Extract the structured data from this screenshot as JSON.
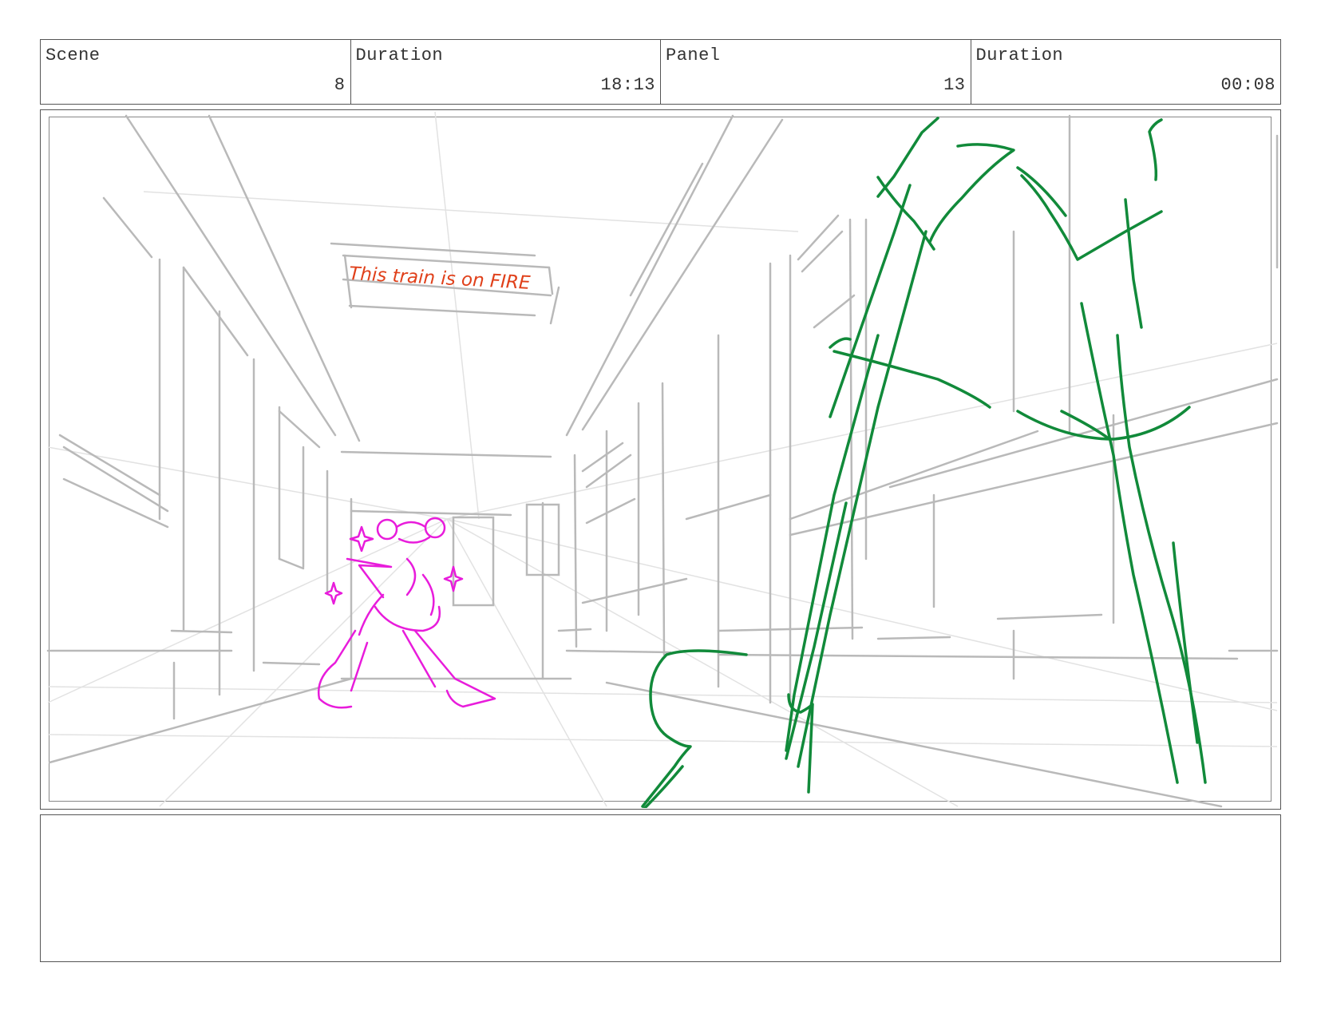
{
  "header": {
    "scene_label": "Scene",
    "scene_value": "8",
    "scene_duration_label": "Duration",
    "scene_duration_value": "18:13",
    "panel_label": "Panel",
    "panel_value": "13",
    "panel_duration_label": "Duration",
    "panel_duration_value": "00:08"
  },
  "panel": {
    "sign_text": "This train is on FIRE"
  },
  "colors": {
    "sketch_gray": "#b8b8b8",
    "character_magenta": "#e81cdb",
    "legs_green": "#118a3a",
    "sign_red": "#e0401a"
  },
  "notes": {
    "text": ""
  }
}
